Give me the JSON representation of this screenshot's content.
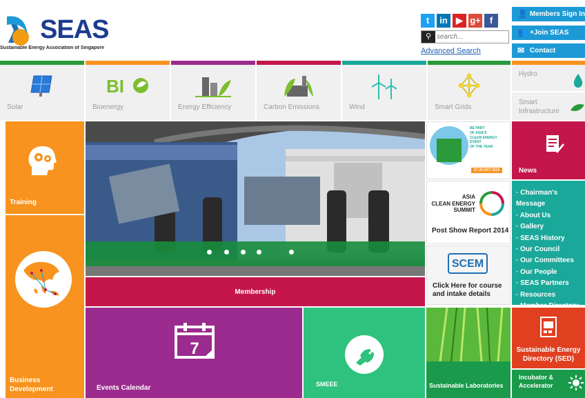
{
  "header": {
    "logo_text": "SEAS",
    "logo_tagline": "Sustainable Energy Association of Singapore",
    "search_placeholder": "search...",
    "advanced_search": "Advanced Search",
    "social": [
      {
        "name": "twitter-icon",
        "glyph": "t",
        "color": "#1da1f2"
      },
      {
        "name": "linkedin-icon",
        "glyph": "in",
        "color": "#0077b5"
      },
      {
        "name": "youtube-icon",
        "glyph": "▶",
        "color": "#d22"
      },
      {
        "name": "google-plus-icon",
        "glyph": "g+",
        "color": "#dd4b39"
      },
      {
        "name": "facebook-icon",
        "glyph": "f",
        "color": "#3b5998"
      }
    ],
    "buttons": {
      "members_sign_in": "Members Sign In",
      "join": "+Join SEAS",
      "contact": "Contact"
    }
  },
  "categories": [
    {
      "label": "Solar",
      "icon": "solar-panel-icon"
    },
    {
      "label": "Bioenergy",
      "icon": "bio-icon"
    },
    {
      "label": "Energy Efficiency",
      "icon": "building-icon"
    },
    {
      "label": "Carbon Emissions",
      "icon": "factory-icon"
    },
    {
      "label": "Wind",
      "icon": "wind-turbine-icon"
    },
    {
      "label": "Smart Grids",
      "icon": "grid-icon"
    }
  ],
  "side_categories": [
    {
      "label": "Hydro"
    },
    {
      "label": "Smart Infrastructure"
    }
  ],
  "tiles": {
    "training": "Training",
    "business_development": "Business Development",
    "membership": "Membership",
    "events_calendar": "Events Calendar",
    "events_calendar_day": "7",
    "smeee": "SMEEE",
    "sustainable_laboratories": "Sustainable Laboratories",
    "news": "News",
    "sed": "Sustainable Energy Directory (SED)",
    "incubator": "Incubator & Accelerator"
  },
  "promo": {
    "poster_lines": [
      "BE PART",
      "OF ASIA'S",
      "CLEAN ENERGY",
      "EVENT",
      "OF THE YEAR"
    ],
    "poster_date": "27-29 OCT 2015",
    "acs_line1": "ASIA",
    "acs_line2": "CLEAN ENERGY",
    "acs_line3": "SUMMIT",
    "acs_report": "Post Show Report 2014",
    "scem_logo": "SCEM",
    "scem_text": "Click Here for course and intake details"
  },
  "about_links": [
    "· Chairman's Message",
    "· About Us",
    "· Gallery",
    "· SEAS History",
    "· Our Council",
    "· Our Committees",
    "· Our People",
    "· SEAS Partners",
    "· Resources",
    "· Member Directory"
  ],
  "colors": {
    "orange": "#f7931e",
    "crimson": "#c4164b",
    "purple": "#9b2b8e",
    "green": "#2ec27e",
    "teal": "#1aa89a",
    "blue": "#1d9ad6",
    "red": "#e04020",
    "darkgreen": "#1a9a4a"
  }
}
